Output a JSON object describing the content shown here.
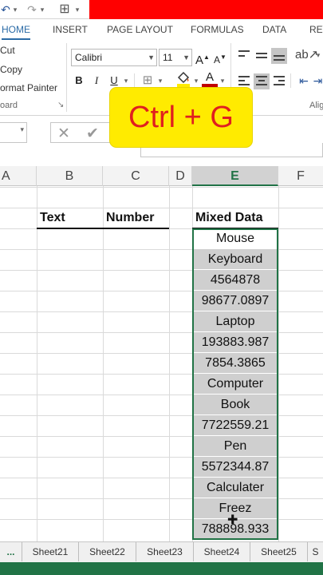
{
  "quick_access": {
    "undo_glyph": "↶",
    "redo_glyph": "↷",
    "borders_glyph": "⊞",
    "dropdown_glyph": "▾"
  },
  "ribbon_tabs": [
    {
      "label": "HOME",
      "active": true
    },
    {
      "label": "INSERT"
    },
    {
      "label": "PAGE LAYOUT"
    },
    {
      "label": "FORMULAS"
    },
    {
      "label": "DATA"
    },
    {
      "label": "REV"
    }
  ],
  "clipboard": {
    "cut": "Cut",
    "copy": "Copy",
    "format_painter": "ormat Painter",
    "group_label": "oard",
    "launcher": "↘"
  },
  "font": {
    "name": "Calibri",
    "size": "11",
    "grow": "A",
    "shrink": "A",
    "bold": "B",
    "italic": "I",
    "underline": "U",
    "font_color": "A"
  },
  "alignment": {
    "group_label": "Alig"
  },
  "formula_bar": {
    "cancel": "✕",
    "enter": "✔"
  },
  "overlay": {
    "shortcut": "Ctrl + G"
  },
  "columns": [
    {
      "label": "A"
    },
    {
      "label": "B"
    },
    {
      "label": "C"
    },
    {
      "label": "D"
    },
    {
      "label": "E",
      "selected": true
    },
    {
      "label": "F"
    }
  ],
  "table": {
    "headers": {
      "text": "Text",
      "number": "Number",
      "mixed": "Mixed Data"
    },
    "mixed_values": [
      "Mouse",
      "Keyboard",
      "4564878",
      "98677.0897",
      "Laptop",
      "193883.987",
      "7854.3865",
      "Computer",
      "Book",
      "7722559.21",
      "Pen",
      "5572344.87",
      "Calculater",
      "Freez",
      "788898.933"
    ]
  },
  "sheet_tabs": {
    "more": "...",
    "tabs": [
      "Sheet21",
      "Sheet22",
      "Sheet23",
      "Sheet24",
      "Sheet25",
      "S"
    ]
  },
  "colors": {
    "excel_green": "#217346",
    "accent_blue": "#2b6ba6",
    "overlay_bg": "#ffeb00",
    "overlay_text": "#e01f1f",
    "top_bar": "#ff0000",
    "selection_fill": "#cfcfcf"
  }
}
